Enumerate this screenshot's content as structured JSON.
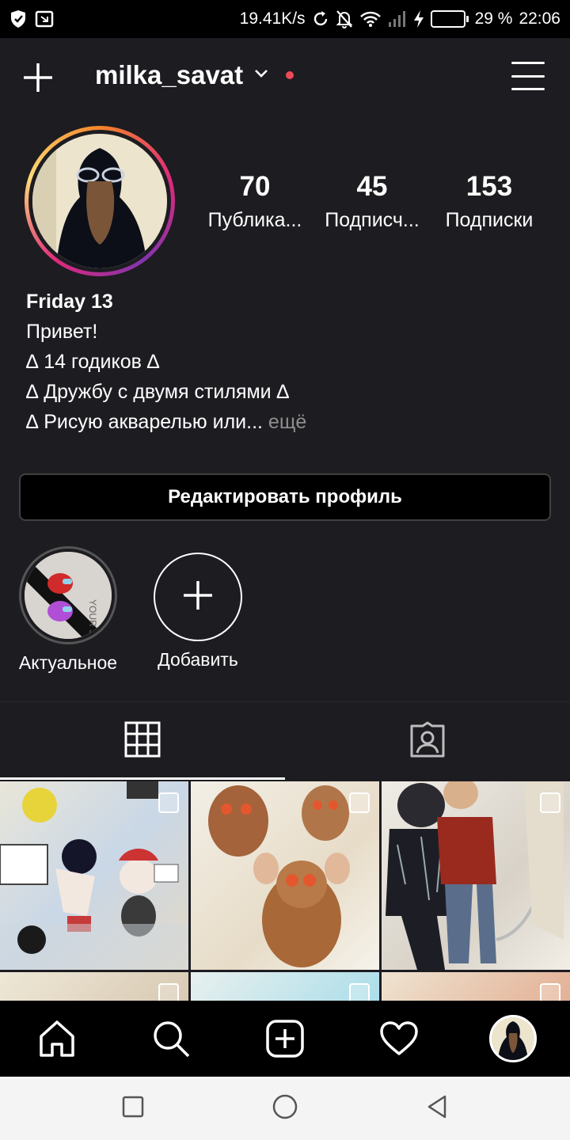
{
  "status_bar": {
    "speed": "19.41K/s",
    "battery_percent": "29 %",
    "battery_level": 0.29,
    "time": "22:06",
    "icons": [
      "shield-icon",
      "screen-icon",
      "sync-icon",
      "bell-off-icon",
      "wifi-icon",
      "signal-icon",
      "charging-icon",
      "battery-icon"
    ]
  },
  "header": {
    "username": "milka_savat",
    "icons": [
      "plus-icon",
      "chevron-down-icon",
      "menu-icon"
    ],
    "notification_dot_color": "#ed4956"
  },
  "profile": {
    "stats": [
      {
        "count": "70",
        "label": "Публика..."
      },
      {
        "count": "45",
        "label": "Подписч..."
      },
      {
        "count": "153",
        "label": "Подписки"
      }
    ],
    "bio": {
      "name": "Friday 13",
      "lines": [
        "Привет!",
        "∆ 14 годиков ∆",
        "∆ Дружбу с двумя стилями ∆",
        "∆ Рисую акварелью или..."
      ],
      "more": "ещё"
    },
    "edit_button": "Редактировать профиль"
  },
  "highlights": [
    {
      "label": "Актуальное"
    },
    {
      "label": "Добавить"
    }
  ],
  "tabs": [
    {
      "icon": "grid-icon",
      "active": true
    },
    {
      "icon": "tagged-icon",
      "active": false
    }
  ],
  "posts_grid": {
    "multi_icon": "multiple-posts-icon"
  },
  "bottom_nav": [
    "home-icon",
    "search-icon",
    "new-post-icon",
    "heart-icon",
    "profile-avatar"
  ],
  "system_nav": [
    "recents-icon",
    "home-circle-icon",
    "back-icon"
  ]
}
